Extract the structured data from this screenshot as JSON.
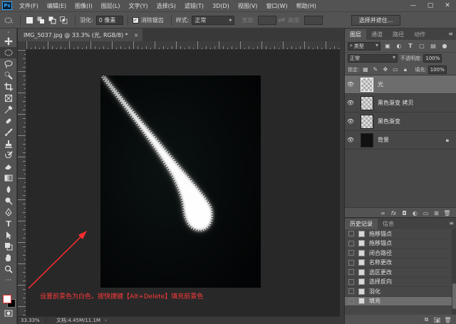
{
  "app": {
    "logo": "Ps",
    "menu": [
      "文件(F)",
      "编辑(E)",
      "图像(I)",
      "图层(L)",
      "文字(Y)",
      "选择(S)",
      "滤镜(T)",
      "3D(D)",
      "视图(V)",
      "窗口(W)",
      "帮助(H)"
    ],
    "window_controls": [
      "—",
      "▢",
      "✕"
    ]
  },
  "options": {
    "feather_label": "羽化:",
    "feather_value": "0 像素",
    "antialias_label": "消除锯齿",
    "antialias_checked": true,
    "style_label": "样式:",
    "style_value": "正常",
    "width_label": "宽度:",
    "height_label": "高度:",
    "select_mask_button": "选择并遮住..."
  },
  "document": {
    "tab_title": "IMG_5037.jpg @ 33.3% (光, RGB/8) *",
    "tab_close": "×",
    "zoom": "33.33%",
    "doc_info": "文档:4.45M/11.1M",
    "status_arrow": "›"
  },
  "annotation": {
    "text": "设置前景色为白色，按快捷键【Alt+Delete】填充前景色",
    "color": "#ff3b3b"
  },
  "colors": {
    "foreground": "#ffffff",
    "background": "#000000"
  },
  "layers_panel": {
    "tabs": [
      "图层",
      "通道",
      "路径",
      "动作"
    ],
    "kind_label": "类型",
    "blend_mode": "正常",
    "opacity_label": "不透明度:",
    "opacity_value": "100%",
    "lock_label": "锁定:",
    "fill_label": "填充:",
    "fill_value": "100%",
    "layers": [
      {
        "name": "光",
        "selected": true,
        "thumb": "transparent"
      },
      {
        "name": "黑色渐变 拷贝",
        "selected": false,
        "thumb": "transparent"
      },
      {
        "name": "黑色渐变",
        "selected": false,
        "thumb": "transparent"
      },
      {
        "name": "背景",
        "selected": false,
        "thumb": "dark",
        "locked": true
      }
    ]
  },
  "history_panel": {
    "tabs": [
      "历史记录",
      "信息"
    ],
    "items": [
      {
        "label": "拖移锚点",
        "selected": false
      },
      {
        "label": "拖移锚点",
        "selected": false
      },
      {
        "label": "闭合路径",
        "selected": false
      },
      {
        "label": "名称更改",
        "selected": false
      },
      {
        "label": "选区更改",
        "selected": false
      },
      {
        "label": "选择反向",
        "selected": false
      },
      {
        "label": "羽化",
        "selected": false
      },
      {
        "label": "填充",
        "selected": true
      }
    ]
  }
}
